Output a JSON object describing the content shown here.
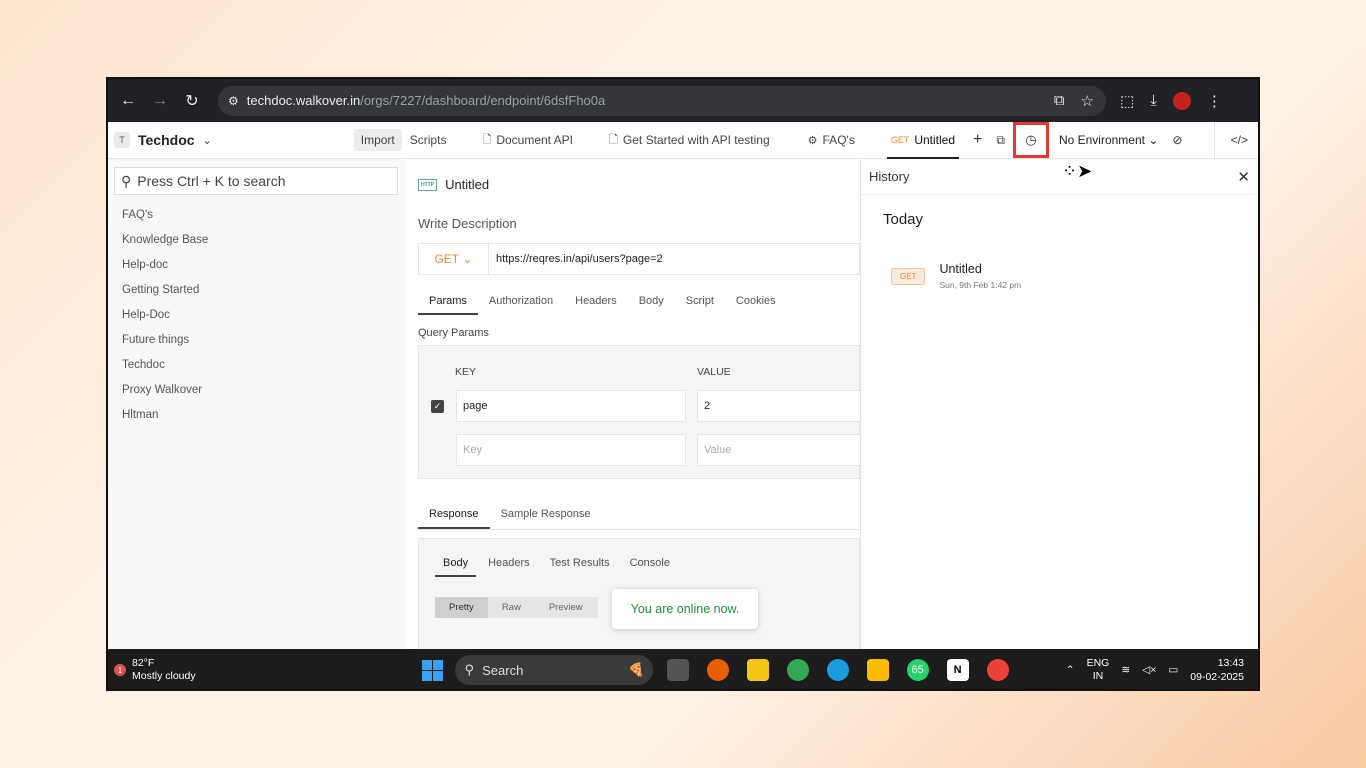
{
  "browser": {
    "url_host": "techdoc.walkover.in",
    "url_path": "/orgs/7227/dashboard/endpoint/6dsfFho0a"
  },
  "app": {
    "workspace_initial": "T",
    "workspace_name": "Techdoc",
    "import_label": "Import",
    "tabs": [
      {
        "label": "Scripts"
      },
      {
        "label": "Document API"
      },
      {
        "label": "Get Started with API testing"
      },
      {
        "label": "FAQ's"
      },
      {
        "method": "GET",
        "label": "Untitled"
      }
    ],
    "environment": "No Environment"
  },
  "sidebar": {
    "search_placeholder": "Press Ctrl + K to search",
    "items": [
      {
        "label": "FAQ's"
      },
      {
        "label": "Knowledge Base"
      },
      {
        "label": "Help-doc"
      },
      {
        "label": "Getting Started"
      },
      {
        "label": "Help-Doc"
      },
      {
        "label": "Future things"
      },
      {
        "label": "Techdoc"
      },
      {
        "label": "Proxy Walkover"
      },
      {
        "label": "Hltman"
      }
    ]
  },
  "endpoint": {
    "badge": "HTTP",
    "title": "Untitled",
    "description_placeholder": "Write Description",
    "method": "GET",
    "url": "https://reqres.in/api/users?page=2",
    "request_tabs": [
      "Params",
      "Authorization",
      "Headers",
      "Body",
      "Script",
      "Cookies"
    ],
    "query_params_title": "Query Params",
    "key_header": "KEY",
    "value_header": "VALUE",
    "params": [
      {
        "key": "page",
        "value": "2",
        "checked": true
      }
    ],
    "key_placeholder": "Key",
    "value_placeholder": "Value",
    "response_tabs": [
      "Response",
      "Sample Response"
    ],
    "body_tabs": [
      "Body",
      "Headers",
      "Test Results",
      "Console"
    ],
    "format_tabs": [
      "Pretty",
      "Raw",
      "Preview"
    ]
  },
  "toast": {
    "message": "You are online now."
  },
  "history": {
    "title": "History",
    "group": "Today",
    "items": [
      {
        "method": "GET",
        "name": "Untitled",
        "time": "Sun, 9th Feb 1:42 pm"
      }
    ]
  },
  "taskbar": {
    "weather_badge": "1",
    "temperature": "82°F",
    "condition": "Mostly cloudy",
    "search_label": "Search",
    "whatsapp_badge": "65",
    "lang_top": "ENG",
    "lang_bottom": "IN",
    "time": "13:43",
    "date": "09-02-2025"
  }
}
